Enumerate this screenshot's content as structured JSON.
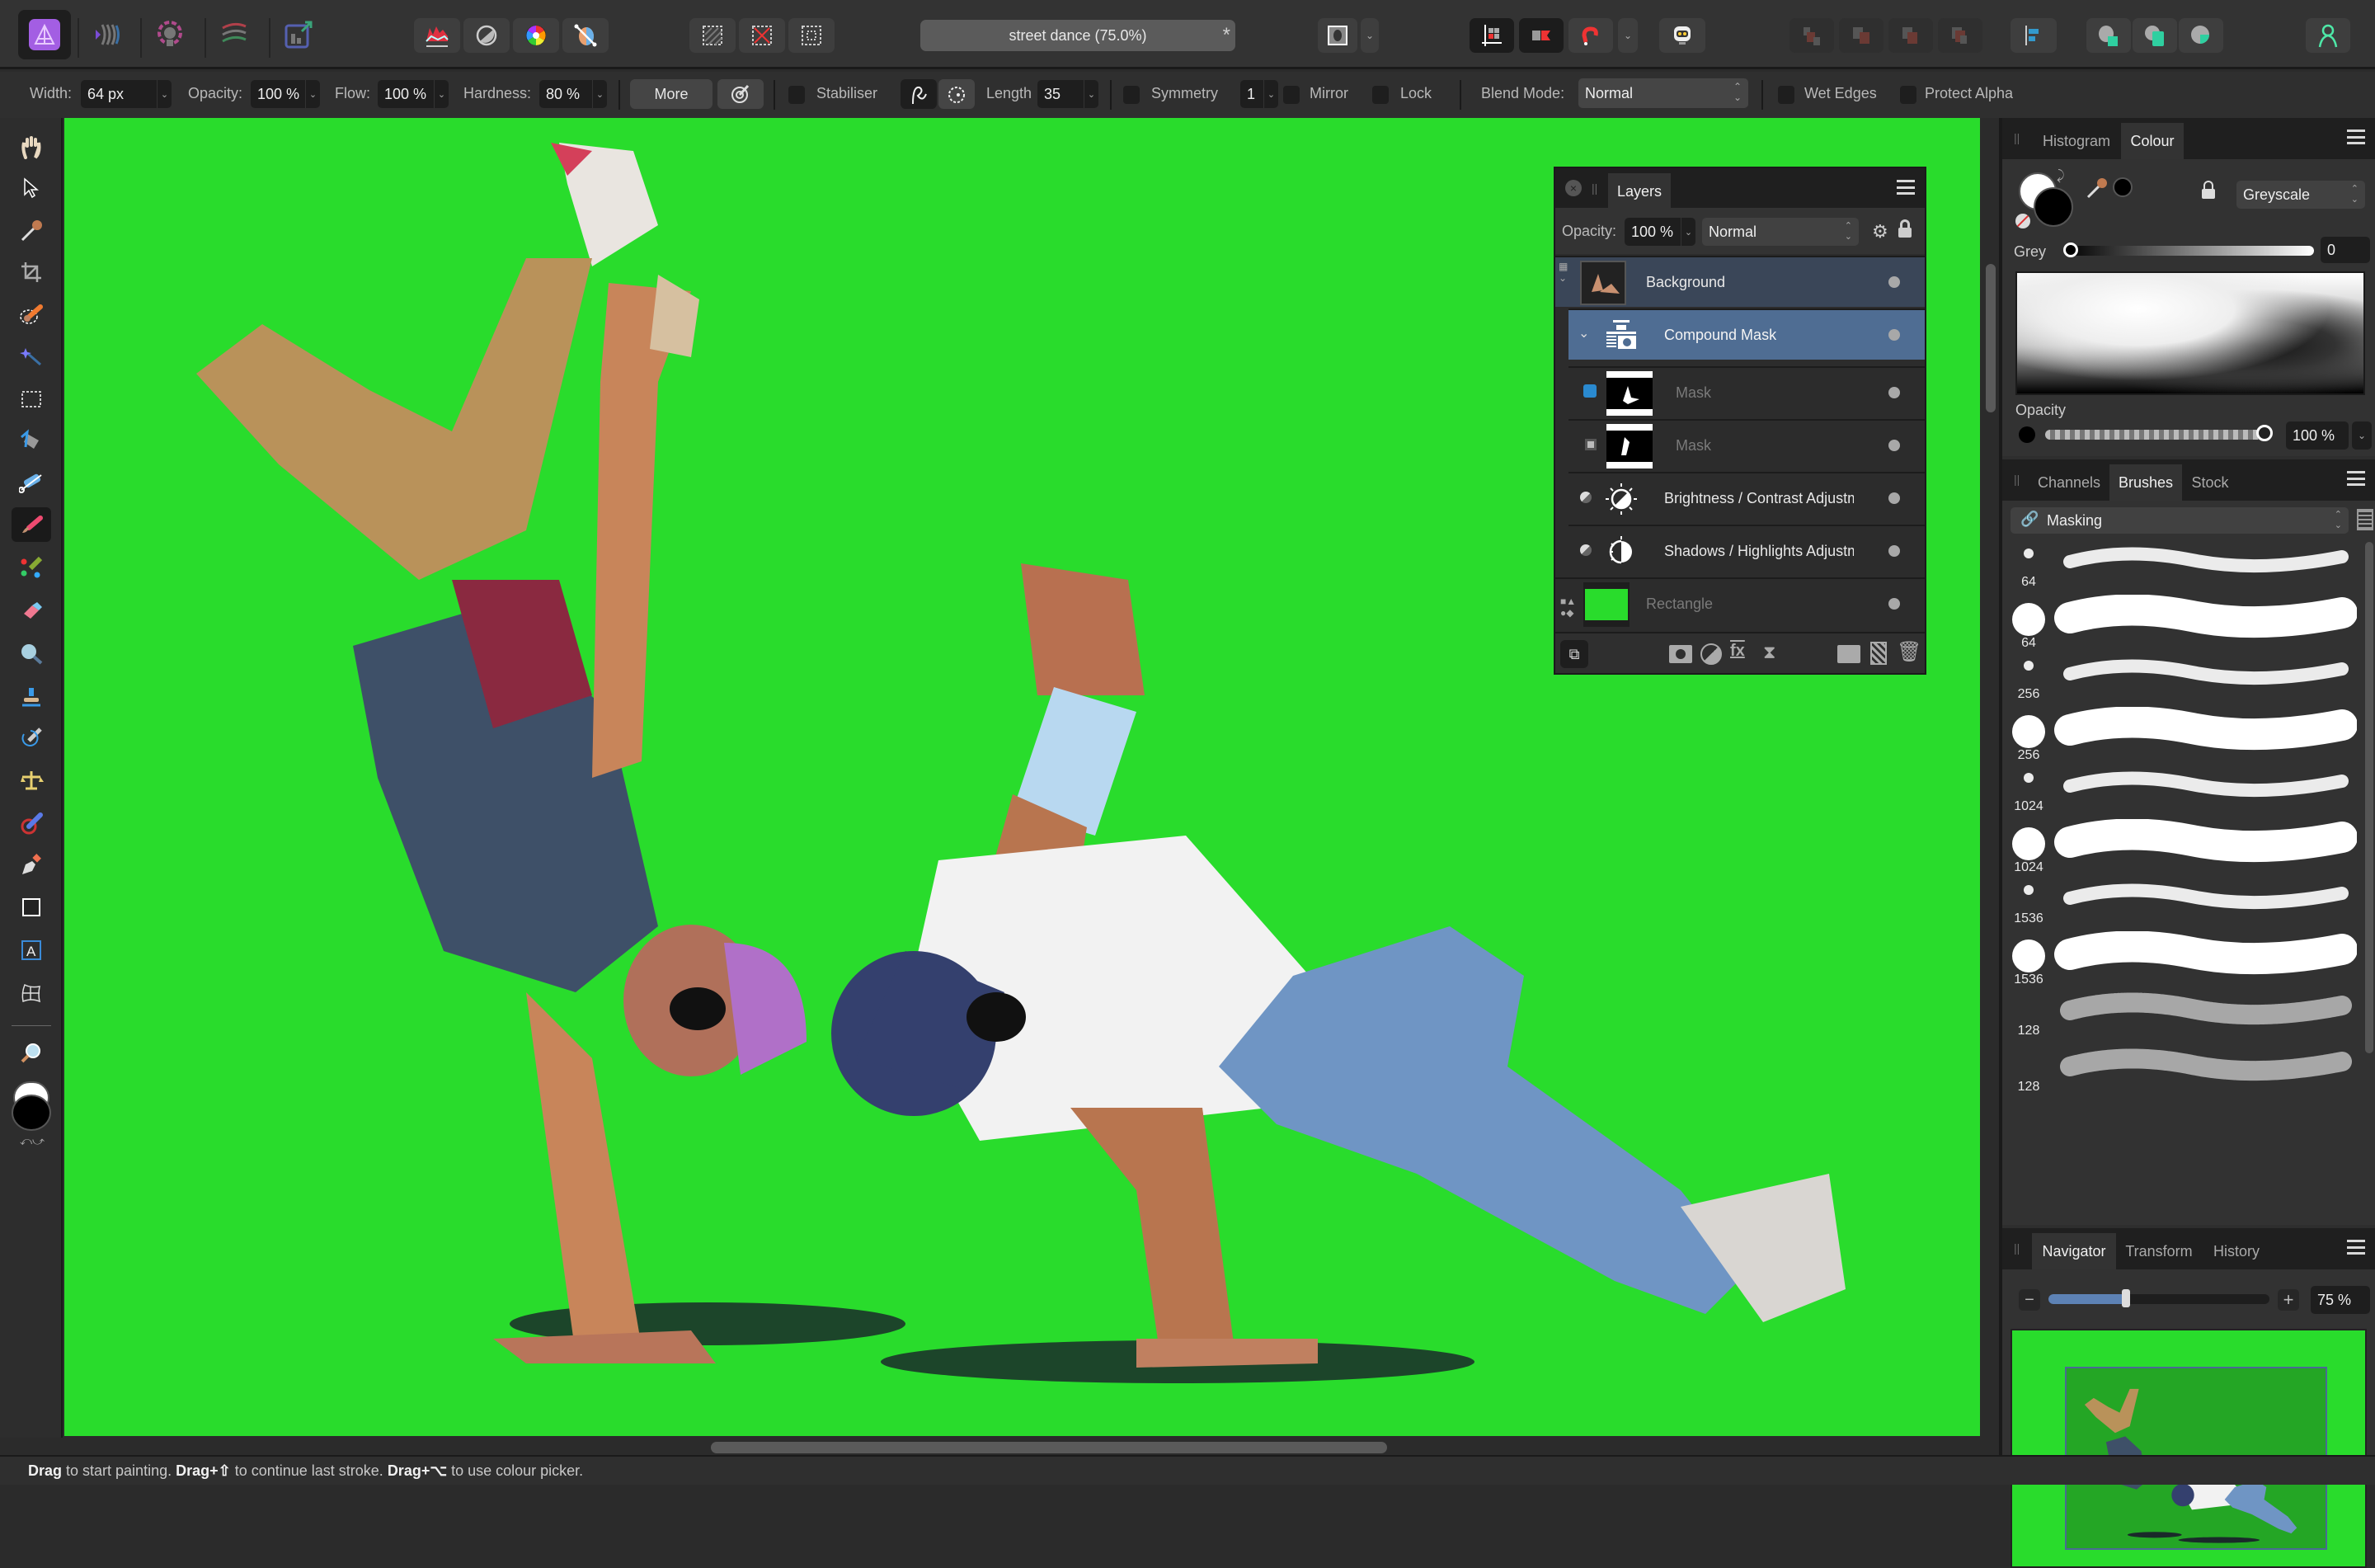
{
  "app": {
    "document_title": "street dance (75.0%)",
    "modified_marker": "*"
  },
  "personas": [
    {
      "name": "photo-persona",
      "active": true
    },
    {
      "name": "liquify-persona"
    },
    {
      "name": "develop-persona"
    },
    {
      "name": "tone-mapping-persona"
    },
    {
      "name": "export-persona"
    }
  ],
  "context_toolbar": {
    "width_label": "Width:",
    "width_value": "64 px",
    "opacity_label": "Opacity:",
    "opacity_value": "100 %",
    "flow_label": "Flow:",
    "flow_value": "100 %",
    "hardness_label": "Hardness:",
    "hardness_value": "80 %",
    "more_label": "More",
    "stabiliser_label": "Stabiliser",
    "length_label": "Length",
    "length_value": "35",
    "symmetry_label": "Symmetry",
    "symmetry_value": "1",
    "mirror_label": "Mirror",
    "lock_label": "Lock",
    "blend_mode_label": "Blend Mode:",
    "blend_mode_value": "Normal",
    "wet_edges_label": "Wet Edges",
    "protect_alpha_label": "Protect Alpha"
  },
  "layers_panel": {
    "tab_label": "Layers",
    "opacity_label": "Opacity:",
    "opacity_value": "100 %",
    "blend_mode": "Normal",
    "layers": [
      {
        "name": "Background",
        "type": "pixel",
        "state": "selected-dim"
      },
      {
        "name": "Compound Mask",
        "type": "compound-mask",
        "state": "selected"
      },
      {
        "name": "Mask",
        "type": "mask",
        "state": "disabled"
      },
      {
        "name": "Mask",
        "type": "mask",
        "state": "disabled"
      },
      {
        "name": "Brightness / Contrast Adjustm",
        "type": "adjustment"
      },
      {
        "name": "Shadows / Highlights Adjustm",
        "type": "adjustment"
      },
      {
        "name": "Rectangle",
        "type": "shape",
        "state": "disabled",
        "color": "#29dc2c"
      }
    ]
  },
  "colour_panel": {
    "tabs": [
      "Histogram",
      "Colour"
    ],
    "active_tab": "Colour",
    "model": "Greyscale",
    "grey_label": "Grey",
    "grey_value": "0",
    "opacity_label": "Opacity",
    "opacity_value": "100 %",
    "primary_colour": "#000000",
    "secondary_colour": "#ffffff"
  },
  "brushes_panel": {
    "tabs": [
      "Channels",
      "Brushes",
      "Stock"
    ],
    "active_tab": "Brushes",
    "category": "Masking",
    "brushes": [
      {
        "size": "64",
        "kind": "soft"
      },
      {
        "size": "64",
        "kind": "hard"
      },
      {
        "size": "256",
        "kind": "soft"
      },
      {
        "size": "256",
        "kind": "hard"
      },
      {
        "size": "1024",
        "kind": "soft"
      },
      {
        "size": "1024",
        "kind": "hard"
      },
      {
        "size": "1536",
        "kind": "soft"
      },
      {
        "size": "1536",
        "kind": "hard"
      },
      {
        "size": "128",
        "kind": "texture"
      },
      {
        "size": "128",
        "kind": "cloud"
      }
    ]
  },
  "navigator_panel": {
    "tabs": [
      "Navigator",
      "Transform",
      "History"
    ],
    "active_tab": "Navigator",
    "zoom_value": "75 %",
    "zoom_slider_fraction": 0.35,
    "minus": "−",
    "plus": "+"
  },
  "status_bar": {
    "parts": [
      {
        "bold": "Drag",
        "text": " to start painting. "
      },
      {
        "bold": "Drag+⇧",
        "text": " to continue last stroke. "
      },
      {
        "bold": "Drag+⌥",
        "text": " to use colour picker."
      }
    ]
  },
  "colors": {
    "canvas_green": "#29dc2c",
    "selection_blue": "#4a6a94",
    "accent_teal": "#2fcfa0"
  }
}
